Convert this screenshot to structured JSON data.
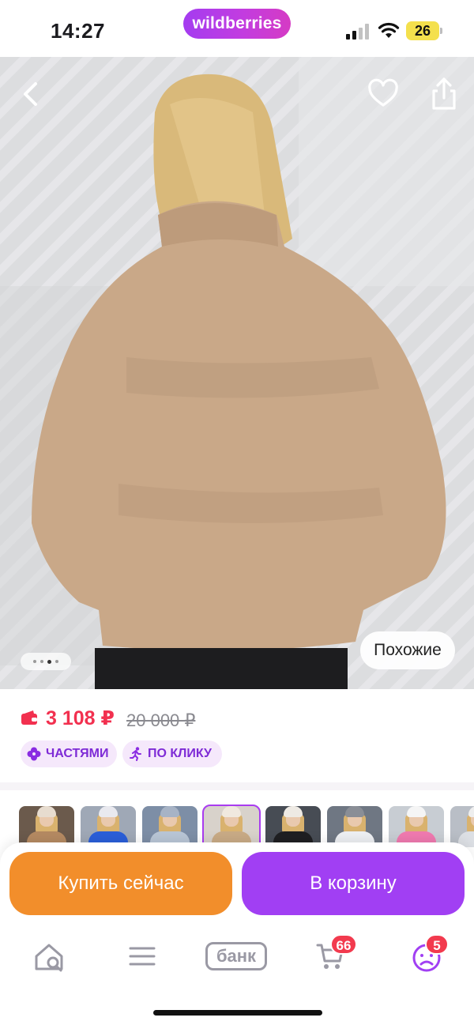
{
  "status_bar": {
    "time": "14:27",
    "app_logo": "wildberries",
    "battery": "26",
    "icons": [
      "signal-icon",
      "wifi-icon",
      "battery-icon"
    ]
  },
  "product_photo": {
    "nav_icons": [
      "chevron-left-icon",
      "heart-icon",
      "share-icon"
    ],
    "similar_label": "Похожие",
    "gallery_pages": 4,
    "gallery_current": 2
  },
  "price_block": {
    "price": "3 108 ₽",
    "old_price": "20 000 ₽",
    "badges": [
      {
        "label": "ЧАСТЯМИ",
        "icon": "clover-icon"
      },
      {
        "label": "ПО КЛИКУ",
        "icon": "running-man-icon"
      }
    ]
  },
  "color_variants": {
    "selected_index": 3,
    "items": [
      {
        "coat": "#b58a62",
        "hat": "#e7dccf",
        "bg": "#6b5a4c"
      },
      {
        "coat": "#2b5fd9",
        "hat": "#e9e9ef",
        "bg": "#9fa8b6"
      },
      {
        "coat": "#b9c6d6",
        "hat": "#a7b3c5",
        "bg": "#7d8ea6"
      },
      {
        "coat": "#c9ab86",
        "hat": "#f0e9df",
        "bg": "#d8d2cb"
      },
      {
        "coat": "#1f1f22",
        "hat": "#eeeae4",
        "bg": "#474c54"
      },
      {
        "coat": "#eef0f3",
        "hat": "#8a8e96",
        "bg": "#6f7783"
      },
      {
        "coat": "#f07ab0",
        "hat": "#f5f5f5",
        "bg": "#c8cdd3"
      },
      {
        "coat": "#dcdfe4",
        "hat": "#eeeeee",
        "bg": "#b9bec6"
      }
    ]
  },
  "actions": {
    "buy_now": "Купить сейчас",
    "add_to_cart": "В корзину"
  },
  "tab_bar": {
    "bank_label": "банк",
    "cart_count": "66",
    "profile_count": "5",
    "icons": [
      "home-search-icon",
      "menu-icon",
      "bank-icon",
      "cart-icon",
      "profile-icon"
    ]
  },
  "colors": {
    "brand_purple": "#a13ff3",
    "buy_orange": "#f28e2b",
    "price_red": "#f2304f",
    "badge_red": "#f23a4e"
  }
}
